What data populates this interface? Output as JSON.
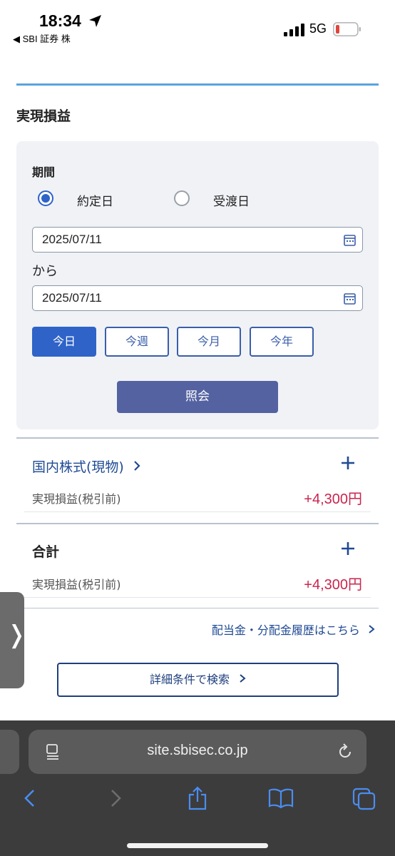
{
  "status_bar": {
    "time": "18:34",
    "back_app": "◀ SBI 証券 株",
    "network": "5G",
    "battery_color": "#e0453c"
  },
  "page": {
    "section_title": "実現損益",
    "filter": {
      "period_label": "期間",
      "radio_options": [
        {
          "label": "約定日",
          "checked": true
        },
        {
          "label": "受渡日",
          "checked": false
        }
      ],
      "from_date": "2025/07/11",
      "connector": "から",
      "to_date": "2025/07/11",
      "range_buttons": [
        {
          "label": "今日",
          "active": true
        },
        {
          "label": "今週",
          "active": false
        },
        {
          "label": "今月",
          "active": false
        },
        {
          "label": "今年",
          "active": false
        }
      ],
      "query_button": "照会"
    },
    "domestic": {
      "title": "国内株式(現物)",
      "pl_label": "実現損益(税引前)",
      "pl_value": "+4,300円"
    },
    "total": {
      "title": "合計",
      "pl_label": "実現損益(税引前)",
      "pl_value": "+4,300円"
    },
    "dividend_link": "配当金・分配金履歴はこちら",
    "detail_search_button": "詳細条件で検索",
    "edge_tab_glyph": "❭"
  },
  "safari": {
    "url": "site.sbisec.co.jp",
    "icons": [
      "reader-icon",
      "reload-icon",
      "back-icon",
      "forward-icon",
      "share-icon",
      "bookmarks-icon",
      "tabs-icon"
    ]
  },
  "colors": {
    "accent_blue": "#2f63c8",
    "link_blue": "#1f4a94",
    "profit_red": "#c8254d",
    "query_button": "#5462a1"
  }
}
